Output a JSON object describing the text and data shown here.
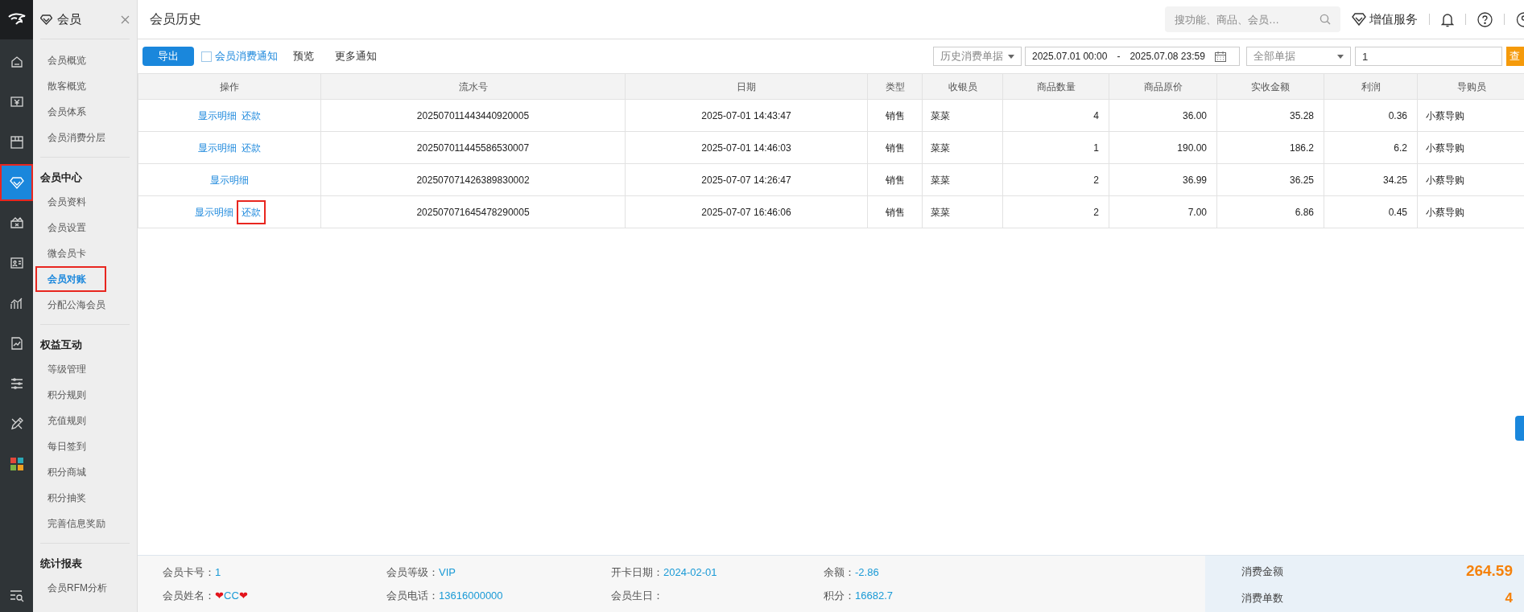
{
  "rail": {
    "items": [
      {
        "selected": false,
        "highlighted": false
      },
      {
        "selected": false,
        "highlighted": false
      },
      {
        "selected": false,
        "highlighted": false
      },
      {
        "selected": true,
        "highlighted": true
      },
      {
        "selected": false,
        "highlighted": false
      },
      {
        "selected": false,
        "highlighted": false
      },
      {
        "selected": false,
        "highlighted": false
      },
      {
        "selected": false,
        "highlighted": false
      },
      {
        "selected": false,
        "highlighted": false
      },
      {
        "selected": false,
        "highlighted": false
      },
      {
        "selected": false,
        "highlighted": false
      }
    ]
  },
  "sidebar": {
    "title": "会员",
    "groups": [
      {
        "items": [
          {
            "label": "会员概览",
            "selected": false,
            "highlighted": false
          },
          {
            "label": "散客概览",
            "selected": false,
            "highlighted": false
          },
          {
            "label": "会员体系",
            "selected": false,
            "highlighted": false
          },
          {
            "label": "会员消费分层",
            "selected": false,
            "highlighted": false
          }
        ]
      },
      {
        "heading": "会员中心",
        "items": [
          {
            "label": "会员资料",
            "selected": false,
            "highlighted": false
          },
          {
            "label": "会员设置",
            "selected": false,
            "highlighted": false
          },
          {
            "label": "微会员卡",
            "selected": false,
            "highlighted": false
          },
          {
            "label": "会员对账",
            "selected": true,
            "highlighted": true
          },
          {
            "label": "分配公海会员",
            "selected": false,
            "highlighted": false
          }
        ]
      },
      {
        "heading": "权益互动",
        "items": [
          {
            "label": "等级管理",
            "selected": false,
            "highlighted": false
          },
          {
            "label": "积分规则",
            "selected": false,
            "highlighted": false
          },
          {
            "label": "充值规则",
            "selected": false,
            "highlighted": false
          },
          {
            "label": "每日签到",
            "selected": false,
            "highlighted": false
          },
          {
            "label": "积分商城",
            "selected": false,
            "highlighted": false
          },
          {
            "label": "积分抽奖",
            "selected": false,
            "highlighted": false
          },
          {
            "label": "完善信息奖励",
            "selected": false,
            "highlighted": false
          }
        ]
      },
      {
        "heading": "统计报表",
        "items": [
          {
            "label": "会员RFM分析",
            "selected": false,
            "highlighted": false
          }
        ]
      }
    ]
  },
  "header": {
    "title": "会员历史",
    "search": {
      "placeholder": "搜功能、商品、会员…"
    },
    "value_added": "增值服务"
  },
  "toolbar": {
    "export": "导出",
    "notify": {
      "label": "会员消费通知",
      "checked": false
    },
    "preview": "预览",
    "more": "更多通知",
    "source_select": "历史消费单据",
    "date_from": "2025.07.01 00:00",
    "date_sep": "-",
    "date_to": "2025.07.08 23:59",
    "type_select": "全部单据",
    "keyword": "1",
    "query": "查"
  },
  "table": {
    "columns": [
      "操作",
      "流水号",
      "日期",
      "类型",
      "收银员",
      "商品数量",
      "商品原价",
      "实收金额",
      "利润",
      "导购员"
    ],
    "rows": [
      {
        "cells": [
          {
            "actions": [
              {
                "label": "显示明细",
                "highlighted": false
              },
              {
                "label": "还款",
                "highlighted": false
              }
            ]
          },
          "202507011443440920005",
          "2025-07-01 14:43:47",
          "销售",
          "菜菜",
          "4",
          "36.00",
          "35.28",
          "0.36",
          "小蔡导购"
        ]
      },
      {
        "cells": [
          {
            "actions": [
              {
                "label": "显示明细",
                "highlighted": false
              },
              {
                "label": "还款",
                "highlighted": false
              }
            ]
          },
          "202507011445586530007",
          "2025-07-01 14:46:03",
          "销售",
          "菜菜",
          "1",
          "190.00",
          "186.2",
          "6.2",
          "小蔡导购"
        ]
      },
      {
        "cells": [
          {
            "actions": [
              {
                "label": "显示明细",
                "highlighted": false
              }
            ]
          },
          "202507071426389830002",
          "2025-07-07 14:26:47",
          "销售",
          "菜菜",
          "2",
          "36.99",
          "36.25",
          "34.25",
          "小蔡导购"
        ]
      },
      {
        "cells": [
          {
            "actions": [
              {
                "label": "显示明细",
                "highlighted": false
              },
              {
                "label": "还款",
                "highlighted": true
              }
            ]
          },
          "202507071645478290005",
          "2025-07-07 16:46:06",
          "销售",
          "菜菜",
          "2",
          "7.00",
          "6.86",
          "0.45",
          "小蔡导购"
        ]
      }
    ]
  },
  "member": {
    "fields": [
      [
        {
          "label": "会员卡号：",
          "value": "1"
        },
        {
          "label": "会员姓名：",
          "value": "❤CC❤"
        }
      ],
      [
        {
          "label": "会员等级：",
          "value": "VIP"
        },
        {
          "label": "会员电话：",
          "value": "13616000000"
        }
      ],
      [
        {
          "label": "开卡日期：",
          "value": "2024-02-01"
        },
        {
          "label": "会员生日："
        }
      ],
      [
        {
          "label": "余额：",
          "value": "-2.86"
        },
        {
          "label": "积分：",
          "value": "16682.7"
        }
      ]
    ],
    "summary": [
      {
        "label": "消费金额",
        "value": "264.59"
      },
      {
        "label": "消费单数",
        "value": "4"
      }
    ]
  }
}
